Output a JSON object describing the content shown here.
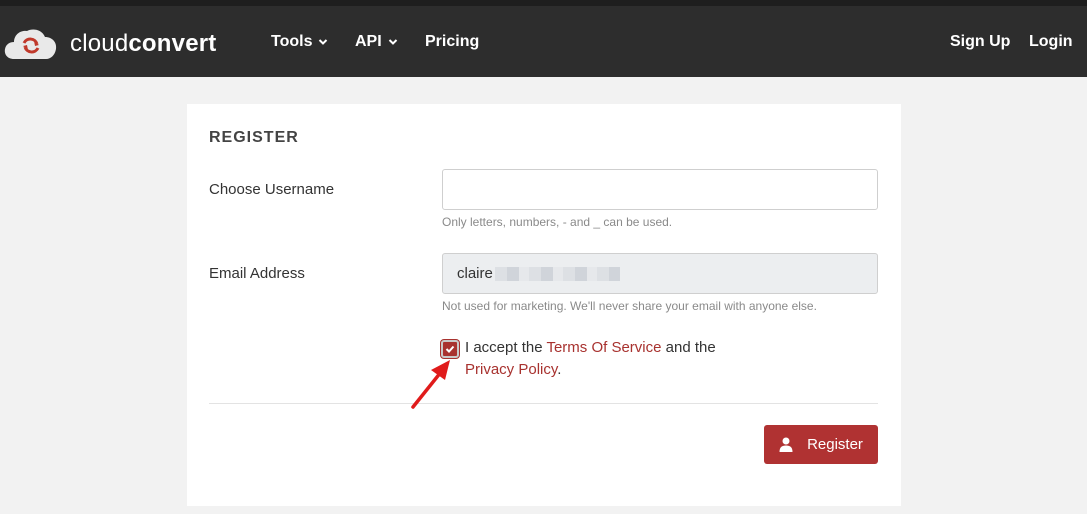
{
  "brand": {
    "name_light": "cloud",
    "name_bold": "convert"
  },
  "nav": {
    "tools": "Tools",
    "api": "API",
    "pricing": "Pricing",
    "signup": "Sign Up",
    "login": "Login"
  },
  "form": {
    "title": "REGISTER",
    "username_label": "Choose Username",
    "username_value": "",
    "username_help": "Only letters, numbers, - and _ can be used.",
    "email_label": "Email Address",
    "email_value": "claire",
    "email_help": "Not used for marketing. We'll never share your email with anyone else.",
    "accept_prefix": "I accept the ",
    "terms_link": "Terms Of Service",
    "accept_middle": " and the",
    "privacy_link": "Privacy Policy",
    "accept_suffix": ".",
    "checkbox_checked": true,
    "submit_label": "Register"
  },
  "colors": {
    "accent": "#b03232",
    "navbar": "#2d2d2d",
    "annotation": "#e01b1b"
  },
  "icons": [
    "cloud-logo-icon",
    "caret-down-icon",
    "check-icon",
    "user-icon",
    "annotation-arrow-icon"
  ]
}
